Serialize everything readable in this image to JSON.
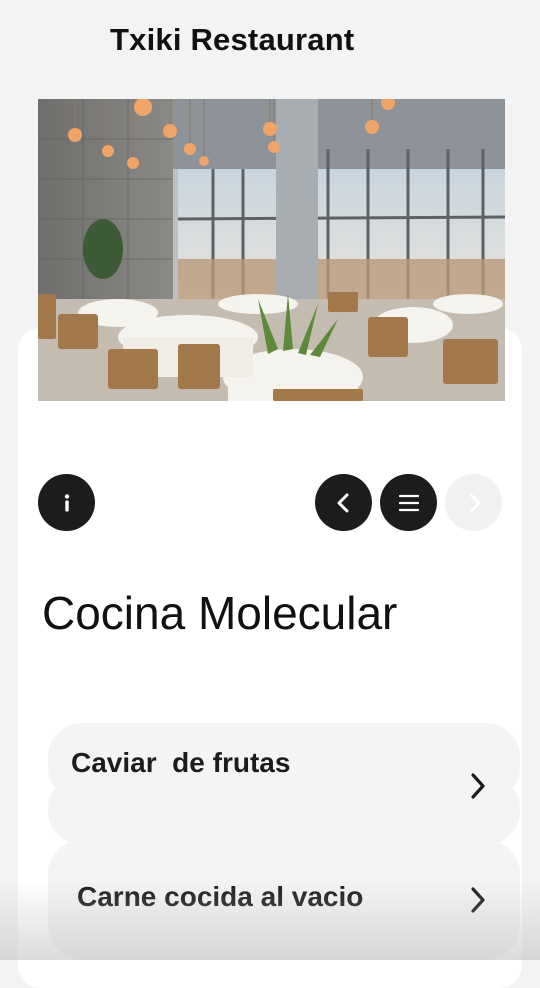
{
  "header": {
    "title": "Txiki Restaurant"
  },
  "hero": {
    "icon": "restaurant-dining-room-photo"
  },
  "controls": {
    "info_icon": "info-icon",
    "prev_icon": "chevron-left-icon",
    "menu_icon": "menu-icon",
    "next_icon": "chevron-right-icon"
  },
  "section": {
    "title": "Cocina Molecular"
  },
  "menu_items": [
    {
      "label": "Caviar  de frutas"
    },
    {
      "label": ""
    },
    {
      "label": "Carne cocida al vacio"
    }
  ],
  "colors": {
    "background": "#f3f3f3",
    "card": "#ffffff",
    "button_dark": "#1c1c1c",
    "button_disabled": "#f1f1f1",
    "item_bg": "#f4f4f4"
  }
}
